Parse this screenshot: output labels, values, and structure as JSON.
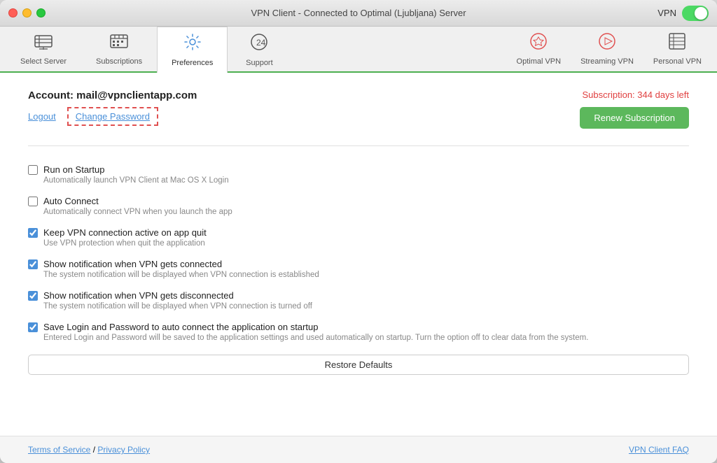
{
  "titlebar": {
    "title": "VPN Client - Connected to Optimal (Ljubljana) Server",
    "vpn_label": "VPN"
  },
  "nav": {
    "tabs": [
      {
        "id": "select-server",
        "label": "Select Server",
        "icon": "⇄",
        "active": false
      },
      {
        "id": "subscriptions",
        "label": "Subscriptions",
        "icon": "▦",
        "active": false
      },
      {
        "id": "preferences",
        "label": "Preferences",
        "icon": "⚙",
        "active": true
      },
      {
        "id": "support",
        "label": "Support",
        "icon": "②",
        "active": false
      }
    ],
    "right_tabs": [
      {
        "id": "optimal-vpn",
        "label": "Optimal VPN",
        "icon": "✦"
      },
      {
        "id": "streaming-vpn",
        "label": "Streaming VPN",
        "icon": "▷"
      },
      {
        "id": "personal-vpn",
        "label": "Personal VPN",
        "icon": "▤"
      }
    ]
  },
  "account": {
    "title": "Account: mail@vpnclientapp.com",
    "logout_label": "Logout",
    "change_password_label": "Change Password",
    "subscription_status": "Subscription: 344 days left",
    "renew_label": "Renew Subscription"
  },
  "settings": [
    {
      "id": "run-on-startup",
      "label": "Run on Startup",
      "description": "Automatically launch VPN Client at Mac OS X Login",
      "checked": false
    },
    {
      "id": "auto-connect",
      "label": "Auto Connect",
      "description": "Automatically connect VPN when you launch the app",
      "checked": false
    },
    {
      "id": "keep-vpn-active",
      "label": "Keep VPN connection active on app quit",
      "description": "Use VPN protection when quit the application",
      "checked": true
    },
    {
      "id": "show-notification-connected",
      "label": "Show notification when VPN gets connected",
      "description": "The system notification will be displayed when VPN connection is established",
      "checked": true
    },
    {
      "id": "show-notification-disconnected",
      "label": "Show notification when VPN gets disconnected",
      "description": "The system notification will be displayed when VPN connection is turned off",
      "checked": true
    },
    {
      "id": "save-login-password",
      "label": "Save Login and Password to auto connect the application on startup",
      "description": "Entered Login and Password will be saved to the application settings and used automatically on startup. Turn the option off to clear data from the system.",
      "checked": true
    }
  ],
  "restore_defaults_label": "Restore Defaults",
  "footer": {
    "terms_label": "Terms of Service",
    "privacy_label": "Privacy Policy",
    "separator": " / ",
    "faq_label": "VPN Client FAQ"
  }
}
